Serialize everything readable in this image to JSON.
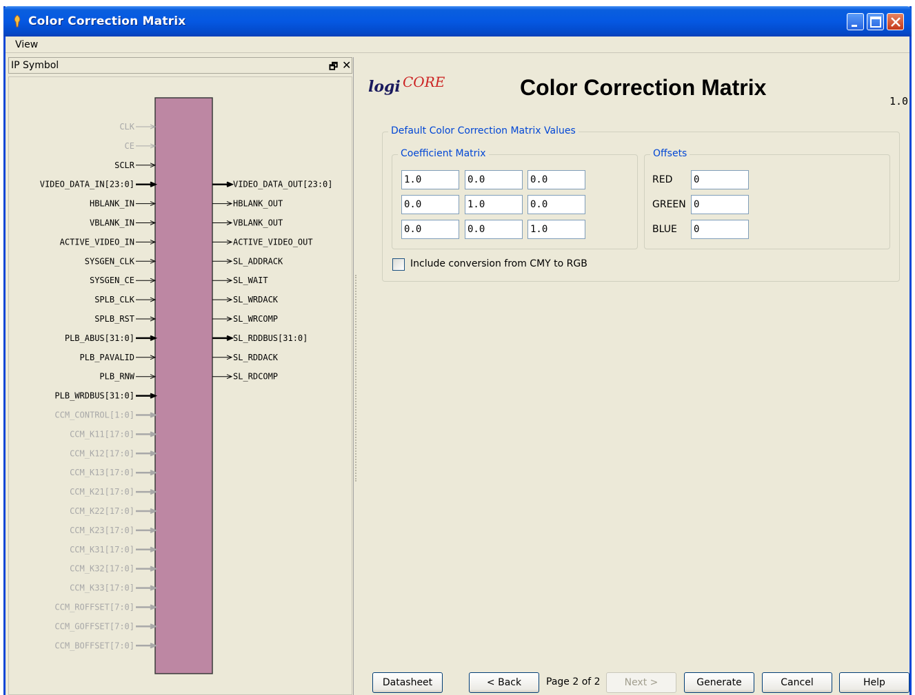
{
  "window": {
    "title": "Color Correction Matrix"
  },
  "menu": {
    "items": [
      "View"
    ]
  },
  "left_panel": {
    "header": "IP Symbol",
    "restore_glyph": "🗗",
    "close_glyph": "✕",
    "symbol": {
      "inputs": [
        {
          "name": "CLK",
          "enabled": false,
          "bus": false
        },
        {
          "name": "CE",
          "enabled": false,
          "bus": false
        },
        {
          "name": "SCLR",
          "enabled": true,
          "bus": false
        },
        {
          "name": "VIDEO_DATA_IN[23:0]",
          "enabled": true,
          "bus": true
        },
        {
          "name": "HBLANK_IN",
          "enabled": true,
          "bus": false
        },
        {
          "name": "VBLANK_IN",
          "enabled": true,
          "bus": false
        },
        {
          "name": "ACTIVE_VIDEO_IN",
          "enabled": true,
          "bus": false
        },
        {
          "name": "SYSGEN_CLK",
          "enabled": true,
          "bus": false
        },
        {
          "name": "SYSGEN_CE",
          "enabled": true,
          "bus": false
        },
        {
          "name": "SPLB_CLK",
          "enabled": true,
          "bus": false
        },
        {
          "name": "SPLB_RST",
          "enabled": true,
          "bus": false
        },
        {
          "name": "PLB_ABUS[31:0]",
          "enabled": true,
          "bus": true
        },
        {
          "name": "PLB_PAVALID",
          "enabled": true,
          "bus": false
        },
        {
          "name": "PLB_RNW",
          "enabled": true,
          "bus": false
        },
        {
          "name": "PLB_WRDBUS[31:0]",
          "enabled": true,
          "bus": true
        },
        {
          "name": "CCM_CONTROL[1:0]",
          "enabled": false,
          "bus": true
        },
        {
          "name": "CCM_K11[17:0]",
          "enabled": false,
          "bus": true
        },
        {
          "name": "CCM_K12[17:0]",
          "enabled": false,
          "bus": true
        },
        {
          "name": "CCM_K13[17:0]",
          "enabled": false,
          "bus": true
        },
        {
          "name": "CCM_K21[17:0]",
          "enabled": false,
          "bus": true
        },
        {
          "name": "CCM_K22[17:0]",
          "enabled": false,
          "bus": true
        },
        {
          "name": "CCM_K23[17:0]",
          "enabled": false,
          "bus": true
        },
        {
          "name": "CCM_K31[17:0]",
          "enabled": false,
          "bus": true
        },
        {
          "name": "CCM_K32[17:0]",
          "enabled": false,
          "bus": true
        },
        {
          "name": "CCM_K33[17:0]",
          "enabled": false,
          "bus": true
        },
        {
          "name": "CCM_ROFFSET[7:0]",
          "enabled": false,
          "bus": true
        },
        {
          "name": "CCM_GOFFSET[7:0]",
          "enabled": false,
          "bus": true
        },
        {
          "name": "CCM_BOFFSET[7:0]",
          "enabled": false,
          "bus": true
        }
      ],
      "outputs": [
        {
          "name": "VIDEO_DATA_OUT[23:0]",
          "slot": 3,
          "bus": true
        },
        {
          "name": "HBLANK_OUT",
          "slot": 4,
          "bus": false
        },
        {
          "name": "VBLANK_OUT",
          "slot": 5,
          "bus": false
        },
        {
          "name": "ACTIVE_VIDEO_OUT",
          "slot": 6,
          "bus": false
        },
        {
          "name": "SL_ADDRACK",
          "slot": 7,
          "bus": false
        },
        {
          "name": "SL_WAIT",
          "slot": 8,
          "bus": false
        },
        {
          "name": "SL_WRDACK",
          "slot": 9,
          "bus": false
        },
        {
          "name": "SL_WRCOMP",
          "slot": 10,
          "bus": false
        },
        {
          "name": "SL_RDDBUS[31:0]",
          "slot": 11,
          "bus": true
        },
        {
          "name": "SL_RDDACK",
          "slot": 12,
          "bus": false
        },
        {
          "name": "SL_RDCOMP",
          "slot": 13,
          "bus": false
        }
      ],
      "colors": {
        "body": "#bd87a3",
        "enabled_pin": "#000000",
        "disabled_pin": "#a8a8a8"
      }
    }
  },
  "right_panel": {
    "logo": {
      "logi": "logi",
      "core": "CORE"
    },
    "title": "Color Correction Matrix",
    "version": "1.0",
    "defaults_group": "Default Color Correction Matrix Values",
    "coefficient_group": "Coefficient Matrix",
    "coefficients": [
      [
        "1.0",
        "0.0",
        "0.0"
      ],
      [
        "0.0",
        "1.0",
        "0.0"
      ],
      [
        "0.0",
        "0.0",
        "1.0"
      ]
    ],
    "offsets_group": "Offsets",
    "offsets": [
      {
        "label": "RED",
        "value": "0"
      },
      {
        "label": "GREEN",
        "value": "0"
      },
      {
        "label": "BLUE",
        "value": "0"
      }
    ],
    "cmy_checkbox": {
      "label": "Include conversion from CMY to RGB",
      "checked": false
    }
  },
  "footer": {
    "datasheet": "Datasheet",
    "back": "< Back",
    "page": "Page 2 of 2",
    "next": "Next >",
    "generate": "Generate",
    "cancel": "Cancel",
    "help": "Help"
  }
}
